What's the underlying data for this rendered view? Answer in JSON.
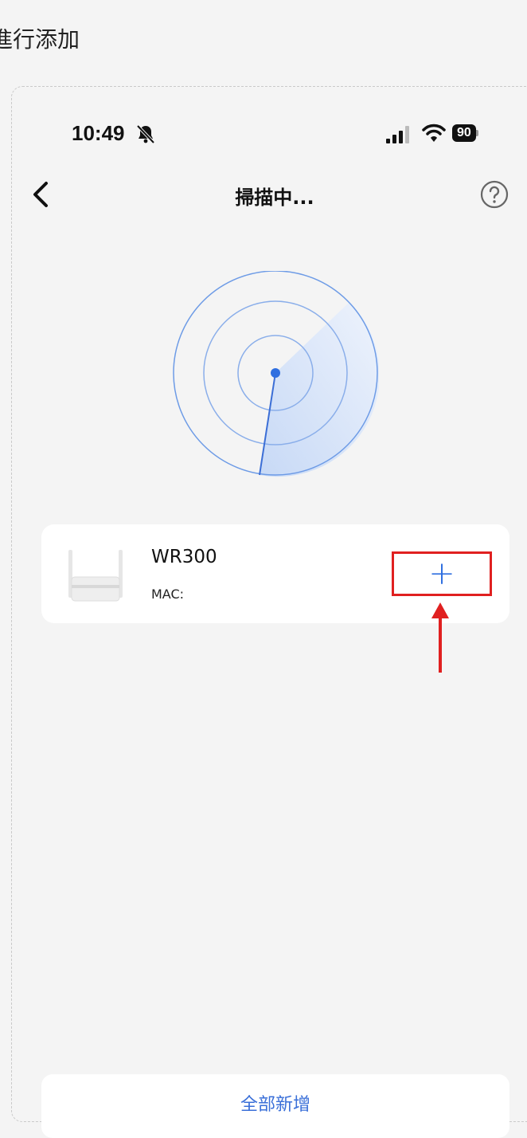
{
  "document": {
    "caption_fragment": "進行添加"
  },
  "status_bar": {
    "time": "10:49",
    "battery": "90"
  },
  "header": {
    "title": "掃描中..."
  },
  "device": {
    "name": "WR300",
    "mac_label": "MAC:",
    "add_symbol": "+"
  },
  "footer": {
    "add_all_label": "全部新增"
  },
  "colors": {
    "accent": "#2f6fe0",
    "highlight": "#e02020",
    "background": "#f4f4f4"
  },
  "icons": [
    "bell-slash-icon",
    "signal-icon",
    "wifi-icon",
    "battery-icon",
    "back-chevron-icon",
    "help-icon",
    "radar-icon",
    "router-icon",
    "arrow-up-icon"
  ]
}
